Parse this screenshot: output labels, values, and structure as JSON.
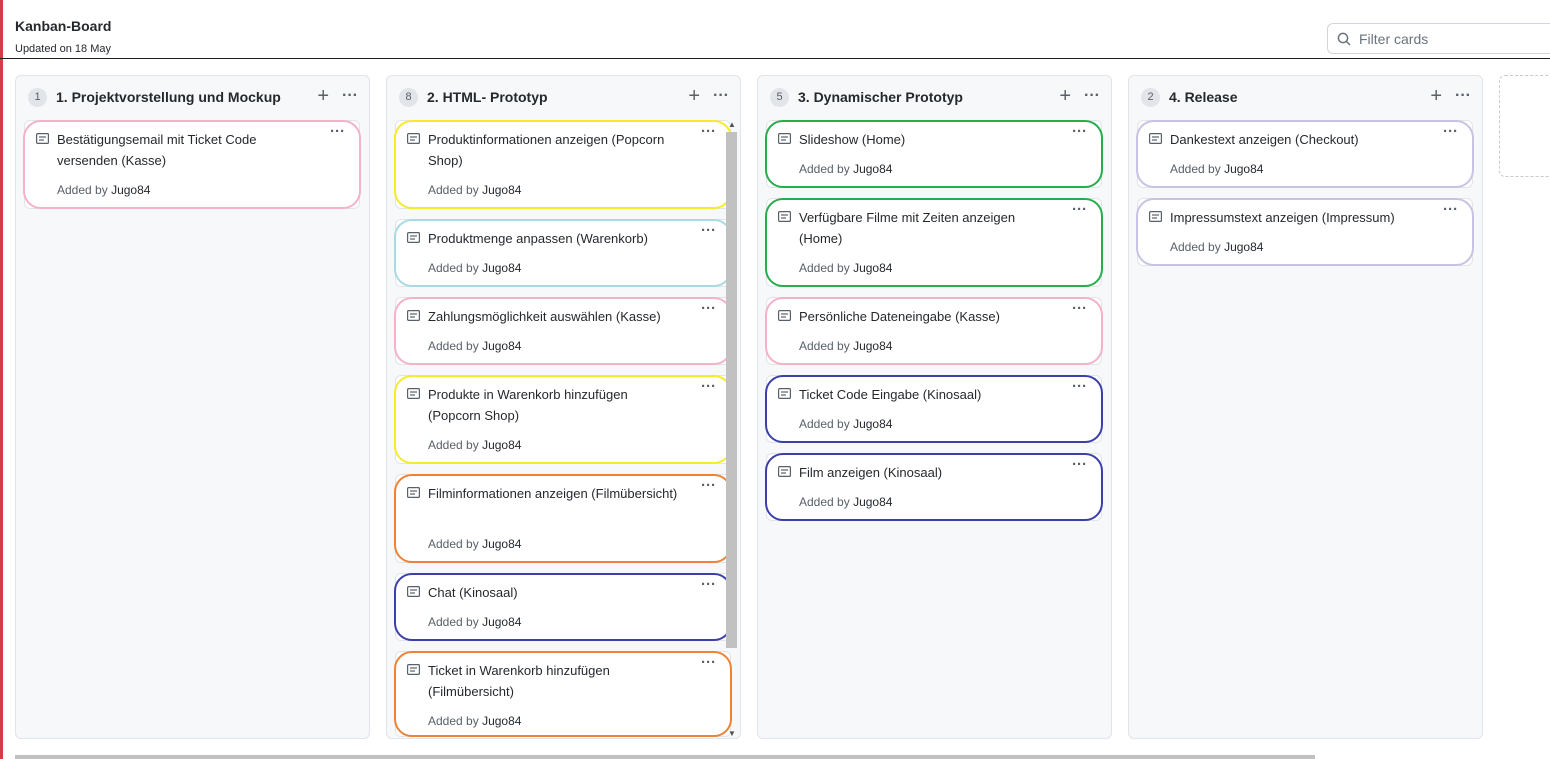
{
  "header": {
    "title": "Kanban-Board",
    "updated": "Updated on 18 May",
    "filter_placeholder": "Filter cards"
  },
  "colors": {
    "pink": "#f4b2c8",
    "yellow": "#f6ea2a",
    "lightblue": "#a9d9e3",
    "orange": "#ee8236",
    "navy": "#3b40a8",
    "green": "#27ae4c",
    "lavender": "#c7c3e3"
  },
  "columns": [
    {
      "count": "1",
      "title": "1. Projektvorstellung und Mockup",
      "cards": [
        {
          "title": "Bestätigungsemail mit Ticket Code versenden (Kasse)",
          "added_by": "Added by",
          "author": "Jugo84",
          "ring": "pink"
        }
      ]
    },
    {
      "count": "8",
      "title": "2. HTML- Prototyp",
      "cards": [
        {
          "title": "Produktinformationen anzeigen (Popcorn Shop)",
          "added_by": "Added by",
          "author": "Jugo84",
          "ring": "yellow"
        },
        {
          "title": "Produktmenge anpassen (Warenkorb)",
          "added_by": "Added by",
          "author": "Jugo84",
          "ring": "lightblue"
        },
        {
          "title": "Zahlungsmöglichkeit auswählen (Kasse)",
          "added_by": "Added by",
          "author": "Jugo84",
          "ring": "pink"
        },
        {
          "title": "Produkte in Warenkorb hinzufügen (Popcorn Shop)",
          "added_by": "Added by",
          "author": "Jugo84",
          "ring": "yellow"
        },
        {
          "title": "Filminformationen anzeigen (Filmübersicht)",
          "added_by": "Added by",
          "author": "Jugo84",
          "ring": "orange"
        },
        {
          "title": "Chat (Kinosaal)",
          "added_by": "Added by",
          "author": "Jugo84",
          "ring": "navy"
        },
        {
          "title": "Ticket in Warenkorb hinzufügen (Filmübersicht)",
          "added_by": "Added by",
          "author": "Jugo84",
          "ring": "orange"
        }
      ]
    },
    {
      "count": "5",
      "title": "3. Dynamischer Prototyp",
      "cards": [
        {
          "title": "Slideshow (Home)",
          "added_by": "Added by",
          "author": "Jugo84",
          "ring": "green"
        },
        {
          "title": "Verfügbare Filme mit Zeiten anzeigen (Home)",
          "added_by": "Added by",
          "author": "Jugo84",
          "ring": "green"
        },
        {
          "title": "Persönliche Dateneingabe (Kasse)",
          "added_by": "Added by",
          "author": "Jugo84",
          "ring": "pink"
        },
        {
          "title": "Ticket Code Eingabe (Kinosaal)",
          "added_by": "Added by",
          "author": "Jugo84",
          "ring": "navy"
        },
        {
          "title": "Film anzeigen (Kinosaal)",
          "added_by": "Added by",
          "author": "Jugo84",
          "ring": "navy"
        }
      ]
    },
    {
      "count": "2",
      "title": "4. Release",
      "cards": [
        {
          "title": "Dankestext anzeigen (Checkout)",
          "added_by": "Added by",
          "author": "Jugo84",
          "ring": "lavender"
        },
        {
          "title": "Impressumstext anzeigen (Impressum)",
          "added_by": "Added by",
          "author": "Jugo84",
          "ring": "lavender"
        }
      ]
    }
  ],
  "icons": {
    "card": "note-icon",
    "menu": "ellipsis-icon",
    "add": "plus-icon",
    "search": "search-icon"
  },
  "glyphs": {
    "plus": "+",
    "more": "···",
    "scroll_up": "▲",
    "scroll_down": "▼"
  }
}
